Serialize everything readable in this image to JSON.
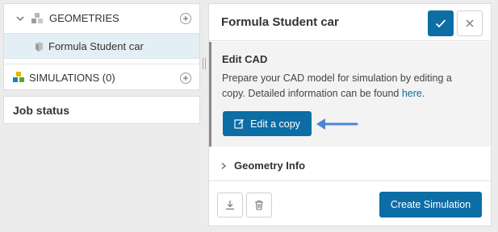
{
  "tree": {
    "geometries_label": "GEOMETRIES",
    "geometry_item_label": "Formula Student car",
    "simulations_label": "SIMULATIONS (0)"
  },
  "job_status": {
    "title": "Job status"
  },
  "detail": {
    "title": "Formula Student car",
    "edit_cad": {
      "heading": "Edit CAD",
      "description": "Prepare your CAD model for simulation by editing a copy. Detailed information can be found",
      "link_text": "here",
      "trailing": ".",
      "button_label": "Edit a copy"
    },
    "geometry_info_label": "Geometry Info",
    "create_simulation_label": "Create Simulation"
  },
  "icons": {
    "chevron_down": "chevron-down-icon",
    "geometries": "cubes-icon",
    "geometry_item": "cube-icon",
    "simulations": "simulations-cubes-icon",
    "add": "plus-icon",
    "confirm": "check-icon",
    "close": "close-icon",
    "edit": "edit-icon",
    "annotation": "arrow-left-icon",
    "chevron_right": "chevron-right-icon",
    "download": "download-icon",
    "delete": "trash-icon"
  },
  "colors": {
    "primary": "#0d6da5",
    "selected_row": "#e4eff5",
    "section_background": "#f3f3f3",
    "annotation_arrow": "#4a86d4"
  }
}
